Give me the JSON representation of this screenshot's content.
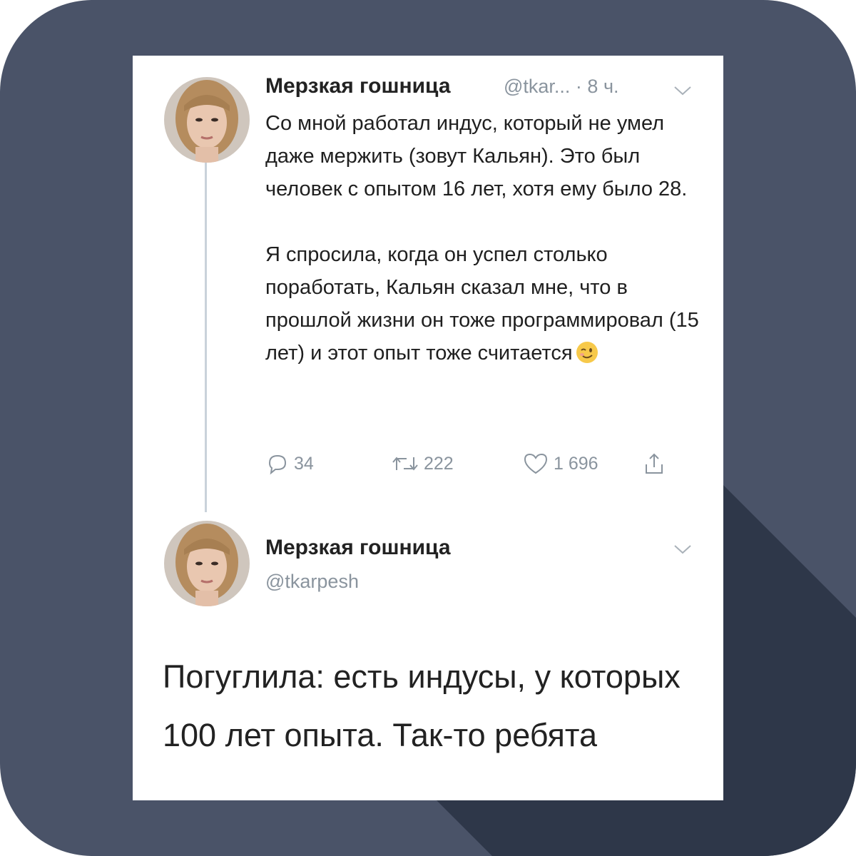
{
  "tweet": {
    "author_name": "Мерзкая гошница",
    "handle_time": "@tkar... · 8 ч.",
    "paragraph1": "Со мной работал индус, который не умел даже мержить (зовут Кальян).  Это был человек с опытом 16 лет, хотя ему было 28.",
    "paragraph2": "Я спросила, когда он успел столько поработать, Кальян сказал мне, что в прошлой жизни он тоже программировал (15 лет) и этот опыт тоже считается",
    "emoji_icon": "winking-face-emoji",
    "actions": {
      "replies": "34",
      "retweets": "222",
      "likes": "1 696"
    }
  },
  "reply": {
    "author_name": "Мерзкая гошница",
    "handle": "@tkarpesh",
    "text": "Погуглила: есть индусы, у которых 100 лет опыта. Так-то ребята"
  },
  "colors": {
    "frame": "#4a5368",
    "frame_shadow": "#2e3749",
    "card": "#ffffff",
    "muted_text": "#8a949e"
  }
}
